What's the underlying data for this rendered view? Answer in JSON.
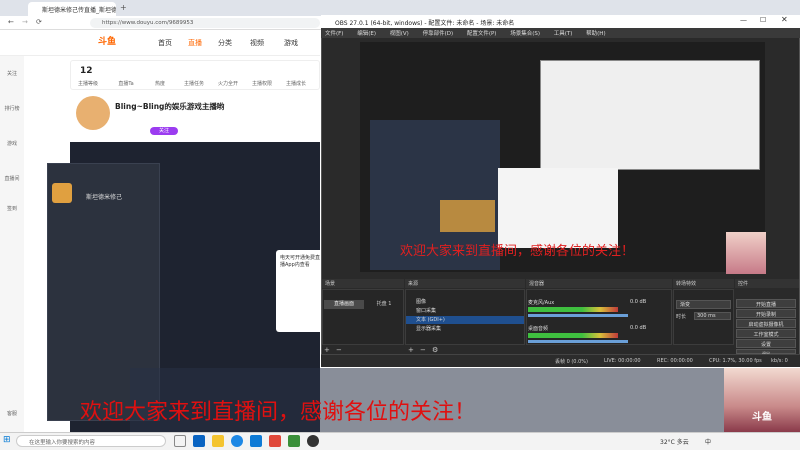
{
  "browser": {
    "tab_title": "斯坦德米修己传直播_斯坦德米修己...",
    "address": "https://www.douyu.com/9689953",
    "logo": "斗鱼",
    "nav": [
      "首页",
      "直播",
      "分类",
      "视频",
      "游戏"
    ],
    "stats": [
      {
        "value": "12",
        "label": "主播等级"
      },
      {
        "value": "",
        "label": "直播Ta"
      },
      {
        "value": "",
        "label": "热度"
      },
      {
        "value": "",
        "label": "主播任务"
      },
      {
        "value": "",
        "label": "火力全开"
      },
      {
        "value": "",
        "label": "主播权限"
      },
      {
        "value": "",
        "label": "主播成长"
      }
    ],
    "streamer_title": "Bling~Bling的娱乐游戏主播哟",
    "follow_label": "关注",
    "sidebar": [
      "关注",
      "排行榜",
      "游戏",
      "直播间",
      "签到",
      "客服"
    ],
    "chat_user": "斯坦德米修己",
    "popup_text": "电天可开通免费直播App内查看"
  },
  "obs": {
    "title": "OBS 27.0.1 (64-bit, windows) - 配置文件: 未命名 - 场景: 未命名",
    "menu": [
      "文件(F)",
      "编辑(E)",
      "视图(V)",
      "停靠部件(D)",
      "配置文件(P)",
      "场景集合(S)",
      "工具(T)",
      "帮助(H)"
    ],
    "preview_ticker": "欢迎大家来到直播间，感谢各位的关注！",
    "docks": {
      "scenes": "场景",
      "sources": "来源",
      "mixer": "混音器",
      "transitions": "转场特效",
      "controls": "控件"
    },
    "scene_items": [
      "直播画面",
      "托盘 1"
    ],
    "sources": [
      "图像",
      "窗口采集",
      "文本 (GDI+)",
      "显示器采集"
    ],
    "mixer": [
      {
        "name": "麦克风/Aux",
        "db": "0.0 dB"
      },
      {
        "name": "桌面音频",
        "db": "0.0 dB"
      }
    ],
    "transition": {
      "type": "渐变",
      "duration_label": "时长",
      "duration": "300 ms"
    },
    "controls": [
      "开始直播",
      "开始录制",
      "启动虚拟摄像机",
      "工作室模式",
      "设置",
      "退出"
    ],
    "status": {
      "dropped": "丢帧 0 (0.0%)",
      "live": "LIVE: 00:00:00",
      "rec": "REC: 00:00:00",
      "cpu": "CPU: 1.7%, 30.00 fps",
      "kbps": "kb/s: 0"
    }
  },
  "overlay": {
    "big_ticker": "欢迎大家来到直播间，感谢各位的关注！",
    "watermark": "斗鱼"
  },
  "taskbar": {
    "search_placeholder": "在这里输入你要搜索的内容",
    "weather": "32°C 多云",
    "lang": "中"
  },
  "colors": {
    "accent": "#ff6600",
    "ticker": "#e01010",
    "obs_bg": "#2a2a2a"
  }
}
